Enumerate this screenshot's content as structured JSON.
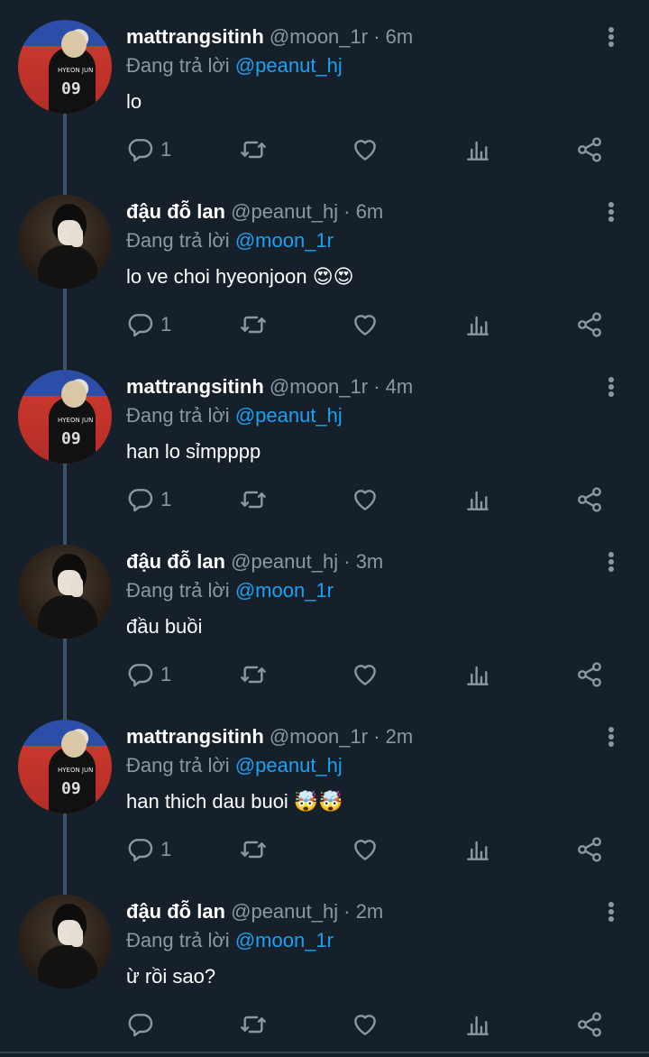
{
  "reply_prefix": "Đang trả lời",
  "tweets": [
    {
      "display_name": "mattrangsitinh",
      "handle": "@moon_1r",
      "time": "6m",
      "reply_to": "@peanut_hj",
      "text": "lo",
      "reply_count": "1",
      "avatar": "a1"
    },
    {
      "display_name": "đậu đỗ lan",
      "handle": "@peanut_hj",
      "time": "6m",
      "reply_to": "@moon_1r",
      "text": "lo ve choi hyeonjoon 😍😍",
      "reply_count": "1",
      "avatar": "a2"
    },
    {
      "display_name": "mattrangsitinh",
      "handle": "@moon_1r",
      "time": "4m",
      "reply_to": "@peanut_hj",
      "text": "han lo sỉmpppp",
      "reply_count": "1",
      "avatar": "a1"
    },
    {
      "display_name": "đậu đỗ lan",
      "handle": "@peanut_hj",
      "time": "3m",
      "reply_to": "@moon_1r",
      "text": "đầu buồi",
      "reply_count": "1",
      "avatar": "a2"
    },
    {
      "display_name": "mattrangsitinh",
      "handle": "@moon_1r",
      "time": "2m",
      "reply_to": "@peanut_hj",
      "text": "han thich dau buoi 🤯🤯",
      "reply_count": "1",
      "avatar": "a1"
    },
    {
      "display_name": "đậu đỗ lan",
      "handle": "@peanut_hj",
      "time": "2m",
      "reply_to": "@moon_1r",
      "text": "ừ rồi sao?",
      "reply_count": "",
      "avatar": "a2"
    }
  ],
  "avatar_a1_jersey_name": "HYEON JUN",
  "avatar_a1_jersey_number": "09",
  "icons": [
    "reply-icon",
    "retweet-icon",
    "like-icon",
    "analytics-icon",
    "share-icon",
    "more-options-icon"
  ],
  "colors": {
    "background": "#15202b",
    "primary_text": "#ffffff",
    "secondary_text": "#8899a6",
    "link": "#1da1f2",
    "thread_line": "#3d5466"
  }
}
